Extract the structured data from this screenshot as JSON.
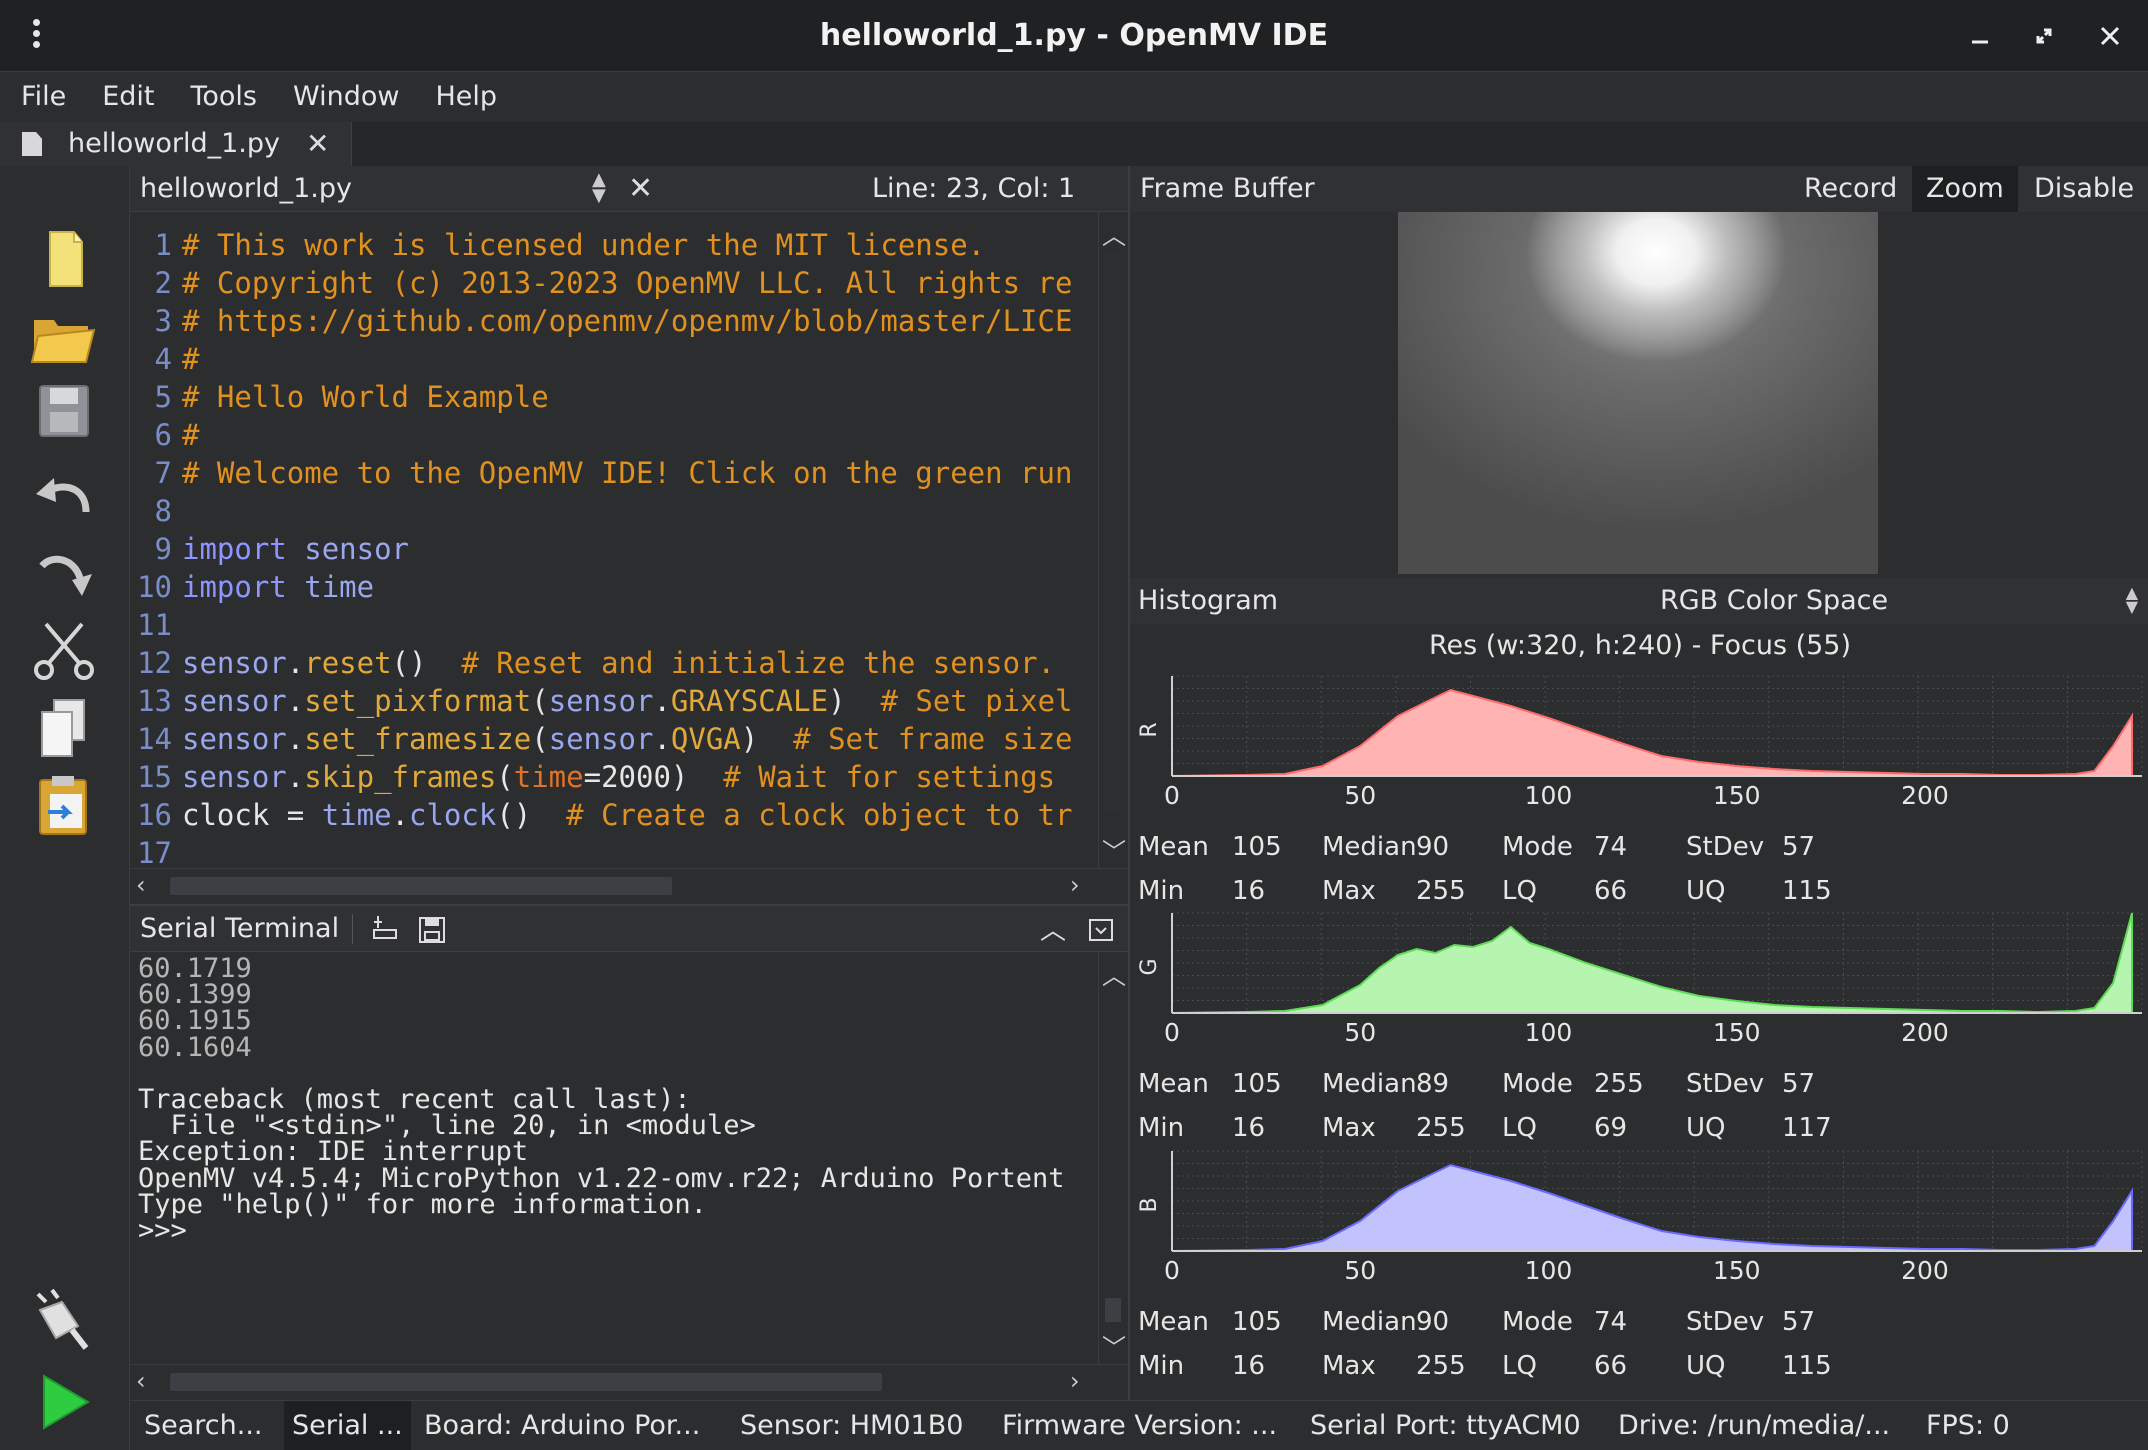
{
  "window": {
    "title": "helloworld_1.py - OpenMV IDE"
  },
  "menu": [
    {
      "label": "File"
    },
    {
      "label": "Edit"
    },
    {
      "label": "Tools"
    },
    {
      "label": "Window"
    },
    {
      "label": "Help"
    }
  ],
  "file_tab": {
    "label": "helloworld_1.py"
  },
  "toolbar": [
    "new-file-icon",
    "open-folder-icon",
    "save-icon",
    "undo-icon",
    "redo-icon",
    "cut-icon",
    "copy-icon",
    "paste-icon",
    "connect-icon",
    "run-icon"
  ],
  "editor": {
    "filename": "helloworld_1.py",
    "position": "Line: 23, Col: 1",
    "lines": [
      {
        "n": "1",
        "tokens": [
          [
            "c-com",
            "# This work is licensed under the MIT license."
          ]
        ]
      },
      {
        "n": "2",
        "tokens": [
          [
            "c-com",
            "# Copyright (c) 2013-2023 OpenMV LLC. All rights re"
          ]
        ]
      },
      {
        "n": "3",
        "tokens": [
          [
            "c-com",
            "# https://github.com/openmv/openmv/blob/master/LICE"
          ]
        ]
      },
      {
        "n": "4",
        "tokens": [
          [
            "c-com",
            "#"
          ]
        ]
      },
      {
        "n": "5",
        "tokens": [
          [
            "c-com",
            "# Hello World Example"
          ]
        ]
      },
      {
        "n": "6",
        "tokens": [
          [
            "c-com",
            "#"
          ]
        ]
      },
      {
        "n": "7",
        "tokens": [
          [
            "c-com",
            "# Welcome to the OpenMV IDE! Click on the green run"
          ]
        ]
      },
      {
        "n": "8",
        "tokens": []
      },
      {
        "n": "9",
        "tokens": [
          [
            "c-kw",
            "import"
          ],
          [
            "c-id",
            " "
          ],
          [
            "c-mod",
            "sensor"
          ]
        ]
      },
      {
        "n": "10",
        "tokens": [
          [
            "c-kw",
            "import"
          ],
          [
            "c-id",
            " "
          ],
          [
            "c-mod",
            "time"
          ]
        ]
      },
      {
        "n": "11",
        "tokens": []
      },
      {
        "n": "12",
        "tokens": [
          [
            "c-mod",
            "sensor"
          ],
          [
            "c-id",
            "."
          ],
          [
            "c-fn",
            "reset"
          ],
          [
            "c-id",
            "()  "
          ],
          [
            "c-com",
            "# Reset and initialize the sensor."
          ]
        ]
      },
      {
        "n": "13",
        "tokens": [
          [
            "c-mod",
            "sensor"
          ],
          [
            "c-id",
            "."
          ],
          [
            "c-fn",
            "set_pixformat"
          ],
          [
            "c-id",
            "("
          ],
          [
            "c-mod",
            "sensor"
          ],
          [
            "c-id",
            "."
          ],
          [
            "c-const",
            "GRAYSCALE"
          ],
          [
            "c-id",
            ")  "
          ],
          [
            "c-com",
            "# Set pixel"
          ]
        ]
      },
      {
        "n": "14",
        "tokens": [
          [
            "c-mod",
            "sensor"
          ],
          [
            "c-id",
            "."
          ],
          [
            "c-fn",
            "set_framesize"
          ],
          [
            "c-id",
            "("
          ],
          [
            "c-mod",
            "sensor"
          ],
          [
            "c-id",
            "."
          ],
          [
            "c-const",
            "QVGA"
          ],
          [
            "c-id",
            ")  "
          ],
          [
            "c-com",
            "# Set frame size"
          ]
        ]
      },
      {
        "n": "15",
        "tokens": [
          [
            "c-mod",
            "sensor"
          ],
          [
            "c-id",
            "."
          ],
          [
            "c-fn",
            "skip_frames"
          ],
          [
            "c-id",
            "("
          ],
          [
            "c-kwarg",
            "time"
          ],
          [
            "c-id",
            "=2000)  "
          ],
          [
            "c-com",
            "# Wait for settings"
          ]
        ]
      },
      {
        "n": "16",
        "tokens": [
          [
            "c-id",
            "clock = "
          ],
          [
            "c-mod",
            "time"
          ],
          [
            "c-id",
            "."
          ],
          [
            "c-mod",
            "clock"
          ],
          [
            "c-id",
            "()  "
          ],
          [
            "c-com",
            "# Create a clock object to tr"
          ]
        ]
      },
      {
        "n": "17",
        "tokens": []
      }
    ]
  },
  "terminal": {
    "title": "Serial Terminal",
    "lines": [
      {
        "text": "60.1719",
        "dim": true
      },
      {
        "text": "60.1399",
        "dim": true
      },
      {
        "text": "60.1915",
        "dim": true
      },
      {
        "text": "60.1604",
        "dim": true
      },
      {
        "text": "",
        "dim": false
      },
      {
        "text": "Traceback (most recent call last):",
        "dim": false
      },
      {
        "text": "  File \"<stdin>\", line 20, in <module>",
        "dim": false
      },
      {
        "text": "Exception: IDE interrupt",
        "dim": false
      },
      {
        "text": "OpenMV v4.5.4; MicroPython v1.22-omv.r22; Arduino Portent",
        "dim": false
      },
      {
        "text": "Type \"help()\" for more information.",
        "dim": false
      },
      {
        "text": ">>>",
        "dim": false
      }
    ]
  },
  "framebuffer": {
    "title": "Frame Buffer",
    "buttons": {
      "record": "Record",
      "zoom": "Zoom",
      "disable": "Disable"
    }
  },
  "histogram": {
    "title": "Histogram",
    "color_space": "RGB Color Space",
    "resolution": "Res (w:320, h:240) - Focus (55)",
    "stat_labels": {
      "mean": "Mean",
      "median": "Median",
      "mode": "Mode",
      "stdev": "StDev",
      "min": "Min",
      "max": "Max",
      "lq": "LQ",
      "uq": "UQ"
    },
    "channels": [
      {
        "name": "R",
        "color": "#ffb3b3",
        "stroke": "#ff6b6b",
        "stats": {
          "mean": "105",
          "median": "90",
          "mode": "74",
          "stdev": "57",
          "min": "16",
          "max": "255",
          "lq": "66",
          "uq": "115"
        }
      },
      {
        "name": "G",
        "color": "#b6f5b0",
        "stroke": "#5fdc55",
        "stats": {
          "mean": "105",
          "median": "89",
          "mode": "255",
          "stdev": "57",
          "min": "16",
          "max": "255",
          "lq": "69",
          "uq": "117"
        }
      },
      {
        "name": "B",
        "color": "#c2c2ff",
        "stroke": "#6a6aff",
        "stats": {
          "mean": "105",
          "median": "90",
          "mode": "74",
          "stdev": "57",
          "min": "16",
          "max": "255",
          "lq": "66",
          "uq": "115"
        }
      }
    ]
  },
  "chart_data": [
    {
      "type": "area",
      "series": [
        {
          "name": "R",
          "x": [
            0,
            10,
            20,
            30,
            40,
            50,
            60,
            68,
            74,
            80,
            90,
            100,
            110,
            120,
            130,
            140,
            150,
            160,
            170,
            180,
            190,
            200,
            210,
            220,
            230,
            240,
            245,
            250,
            255
          ],
          "values": [
            0,
            0.5,
            1,
            2,
            10,
            30,
            60,
            75,
            86,
            80,
            70,
            58,
            45,
            32,
            20,
            14,
            10,
            7,
            5,
            4,
            3,
            2,
            2,
            1,
            1,
            2,
            5,
            30,
            60
          ]
        }
      ],
      "xticks": [
        "0",
        "50",
        "100",
        "150",
        "200"
      ],
      "xlim": [
        0,
        255
      ]
    },
    {
      "type": "area",
      "series": [
        {
          "name": "G",
          "x": [
            0,
            10,
            20,
            30,
            40,
            50,
            55,
            60,
            65,
            70,
            75,
            80,
            85,
            90,
            95,
            100,
            110,
            120,
            130,
            140,
            150,
            160,
            170,
            180,
            190,
            200,
            210,
            220,
            230,
            240,
            245,
            250,
            255
          ],
          "values": [
            0,
            0.5,
            1,
            2,
            8,
            28,
            45,
            58,
            64,
            60,
            68,
            66,
            72,
            86,
            70,
            64,
            50,
            38,
            26,
            17,
            12,
            8,
            6,
            5,
            4,
            3,
            2,
            2,
            1,
            2,
            5,
            30,
            100
          ]
        }
      ],
      "xticks": [
        "0",
        "50",
        "100",
        "150",
        "200"
      ],
      "xlim": [
        0,
        255
      ]
    },
    {
      "type": "area",
      "series": [
        {
          "name": "B",
          "x": [
            0,
            10,
            20,
            30,
            40,
            50,
            60,
            68,
            74,
            80,
            90,
            100,
            110,
            120,
            130,
            140,
            150,
            160,
            170,
            180,
            190,
            200,
            210,
            220,
            230,
            240,
            245,
            250,
            255
          ],
          "values": [
            0,
            0.5,
            1,
            2,
            10,
            30,
            60,
            75,
            86,
            80,
            70,
            58,
            45,
            32,
            20,
            14,
            10,
            7,
            5,
            4,
            3,
            2,
            2,
            1,
            1,
            2,
            5,
            30,
            60
          ]
        }
      ],
      "xticks": [
        "0",
        "50",
        "100",
        "150",
        "200"
      ],
      "xlim": [
        0,
        255
      ]
    }
  ],
  "statusbar": {
    "search": "Search...",
    "serial": "Serial ...",
    "board": "Board: Arduino Por...",
    "sensor": "Sensor: HM01B0",
    "firmware": "Firmware Version: ...",
    "port": "Serial Port: ttyACM0",
    "drive": "Drive: /run/media/...",
    "fps": "FPS: 0"
  }
}
